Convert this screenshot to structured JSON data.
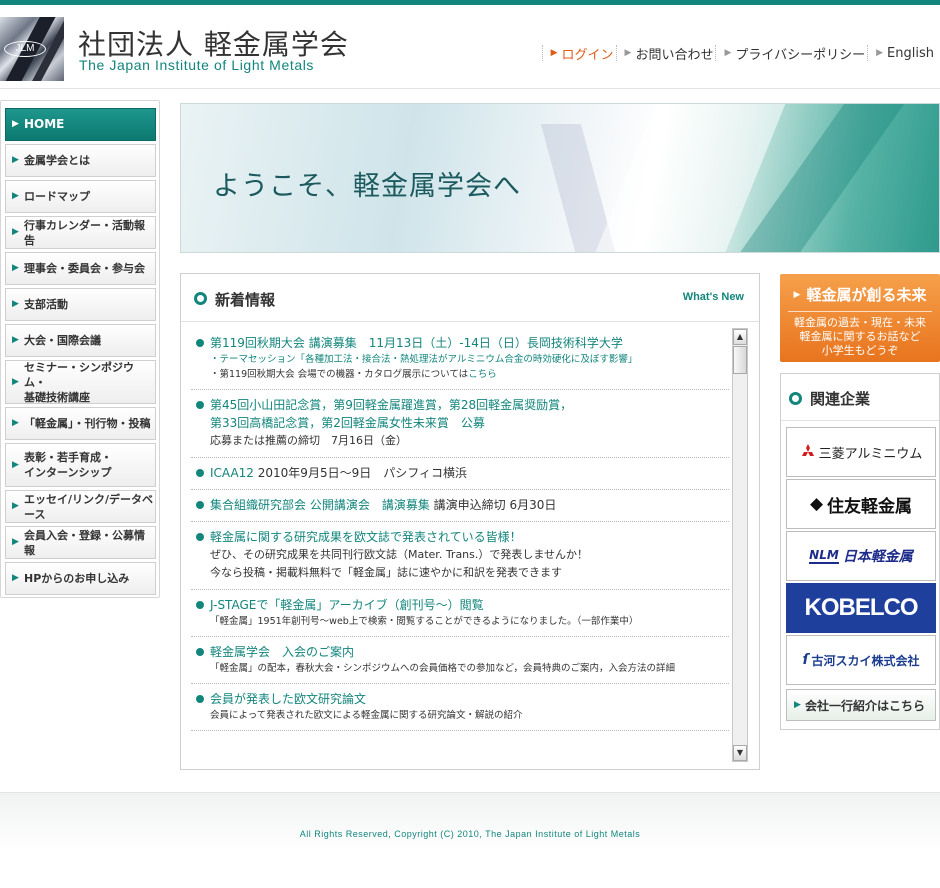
{
  "colors": {
    "accent": "#12857c",
    "login": "#e05a1a",
    "orange": "#f08a30"
  },
  "header": {
    "logo_mark_text": "JLM",
    "org_name_jp": "社団法人 軽金属学会",
    "org_name_en": "The Japan Institute of Light Metals"
  },
  "topnav": {
    "login": "ログイン",
    "contact": "お問い合わせ",
    "privacy": "プライバシーポリシー",
    "english": "English"
  },
  "sidebar": {
    "items": [
      {
        "label": "HOME"
      },
      {
        "label": "金属学会とは"
      },
      {
        "label": "ロードマップ"
      },
      {
        "label": "行事カレンダー・活動報告"
      },
      {
        "label": "理事会・委員会・参与会"
      },
      {
        "label": "支部活動"
      },
      {
        "label": "大会・国際会議"
      },
      {
        "label": "セミナー・シンポジウム・",
        "label2": "基礎技術講座"
      },
      {
        "label": "「軽金属」・刊行物・投稿"
      },
      {
        "label": "表彰・若手育成・",
        "label2": "インターンシップ"
      },
      {
        "label": "エッセイ/リンク/データベース"
      },
      {
        "label": "会員入会・登録・公募情報"
      },
      {
        "label": "HPからのお申し込み"
      }
    ]
  },
  "banner": {
    "message": "ようこそ、軽金属学会へ"
  },
  "news": {
    "title": "新着情報",
    "whats_new": "What's New",
    "items": [
      {
        "title": "第119回秋期大会 講演募集　11月13日（土）-14日（日）長岡技術科学大学",
        "sub1": "・テーマセッション「各種加工法・接合法・熱処理法がアルミニウム合金の時効硬化に及ぼす影響」",
        "sub2": "・第119回秋期大会 会場での機器・カタログ展示については",
        "sub2_link": "こちら"
      },
      {
        "title": "第45回小山田記念賞，第9回軽金属躍進賞，第28回軽金属奨励賞，",
        "title2": "第33回高橋記念賞，第2回軽金属女性未来賞　公募",
        "sub1": "応募または推薦の締切　7月16日（金）"
      },
      {
        "title": "ICAA12",
        "title_rest": " 2010年9月5日～9日　パシフィコ横浜"
      },
      {
        "title": "集合組織研究部会 公開講演会　講演募集",
        "title_rest": " 講演申込締切 6月30日"
      },
      {
        "title": "軽金属に関する研究成果を欧文誌で発表されている皆様！",
        "sub1": "ぜひ、その研究成果を共同刊行欧文誌（Mater. Trans.）で発表しませんか！",
        "sub2": "今なら投稿・掲載料無料で「軽金属」誌に速やかに和訳を発表できます"
      },
      {
        "title": "J-STAGEで「軽金属」アーカイブ（創刊号～）閲覧",
        "sub1": "「軽金属」1951年創刊号～web上で検索・閲覧することができるようになりました。（一部作業中）"
      },
      {
        "title": "軽金属学会　入会のご案内",
        "sub1": "「軽金属」の配本，春秋大会・シンポジウムへの会員価格での参加など，会員特典のご案内，入会方法の詳細"
      },
      {
        "title": "会員が発表した欧文研究論文",
        "sub1": "会員によって発表された欧文による軽金属に関する研究論文・解説の紹介"
      }
    ]
  },
  "future_banner": {
    "title": "軽金属が創る未来",
    "sub1": "軽金属の過去・現在・未来",
    "sub2": "軽金属に関するお話など",
    "sub3": "小学生もどうぞ"
  },
  "related": {
    "title": "関連企業",
    "sponsors": {
      "mitsubishi": "三菱アルミニウム",
      "sumitomo": "住友軽金属",
      "nlm_tag": "NLM",
      "nlm": "日本軽金属",
      "kobelco": "KOBELCO",
      "furukawa": "古河スカイ株式会社"
    },
    "intro_button": "会社一行紹介はこちら"
  },
  "footer": {
    "copyright": "All Rights Reserved, Copyright (C) 2010, The Japan Institute of Light Metals"
  }
}
